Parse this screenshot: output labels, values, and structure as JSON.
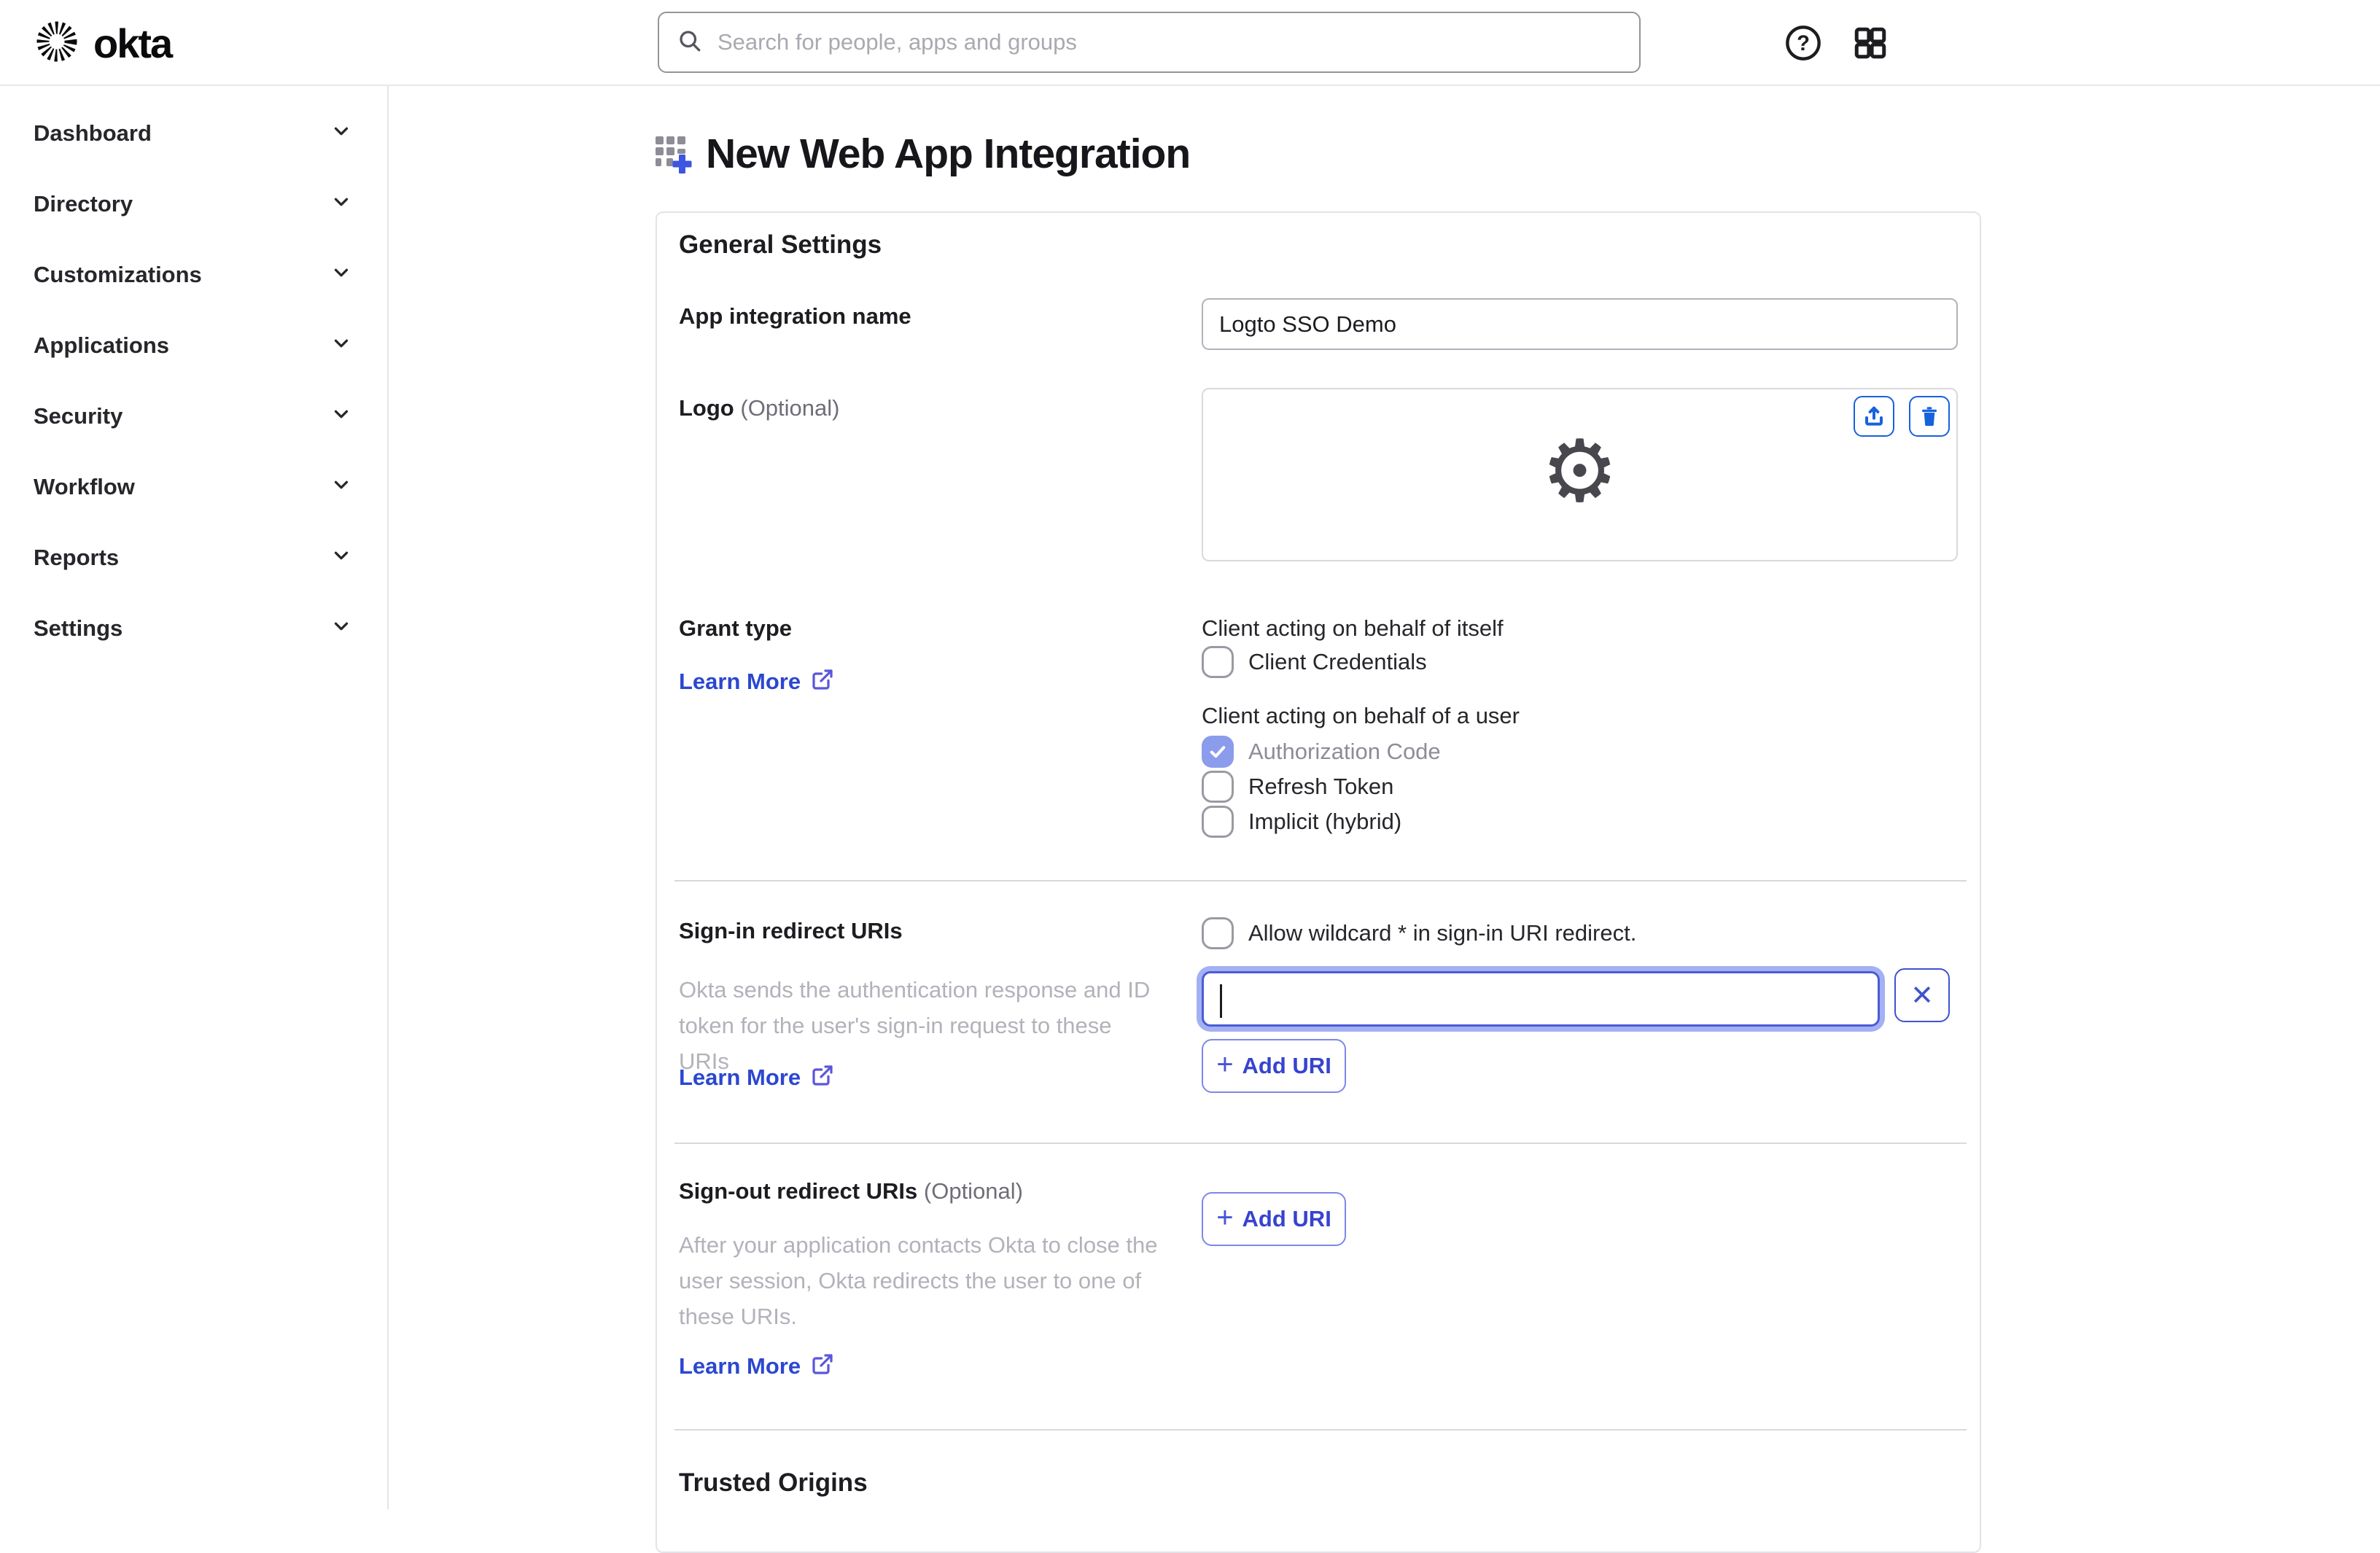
{
  "header": {
    "brand": "okta",
    "search_placeholder": "Search for people, apps and groups"
  },
  "sidebar": {
    "items": [
      {
        "label": "Dashboard"
      },
      {
        "label": "Directory"
      },
      {
        "label": "Customizations"
      },
      {
        "label": "Applications"
      },
      {
        "label": "Security"
      },
      {
        "label": "Workflow"
      },
      {
        "label": "Reports"
      },
      {
        "label": "Settings"
      }
    ]
  },
  "page": {
    "title": "New Web App Integration"
  },
  "general": {
    "heading": "General Settings",
    "app_name": {
      "label": "App integration name",
      "value": "Logto SSO Demo"
    },
    "logo": {
      "label": "Logo",
      "optional": "(Optional)"
    },
    "grant": {
      "label": "Grant type",
      "learn_more": "Learn More",
      "self_heading": "Client acting on behalf of itself",
      "self_option": {
        "label": "Client Credentials",
        "checked": false
      },
      "user_heading": "Client acting on behalf of a user",
      "user_options": [
        {
          "label": "Authorization Code",
          "checked": true,
          "disabled": true
        },
        {
          "label": "Refresh Token",
          "checked": false
        },
        {
          "label": "Implicit (hybrid)",
          "checked": false
        }
      ]
    },
    "signin": {
      "label": "Sign-in redirect URIs",
      "wildcard_label": "Allow wildcard * in sign-in URI redirect.",
      "description": "Okta sends the authentication response and ID token for the user's sign-in request to these URIs",
      "learn_more": "Learn More",
      "input_value": "",
      "clear_label": "✕",
      "add_uri": "Add URI",
      "plus": "+"
    },
    "signout": {
      "label": "Sign-out redirect URIs",
      "optional": "(Optional)",
      "description": "After your application contacts Okta to close the user session, Okta redirects the user to one of these URIs.",
      "learn_more": "Learn More",
      "add_uri": "Add URI",
      "plus": "+"
    },
    "trusted_heading": "Trusted Origins"
  },
  "icons": {
    "gear": "⚙"
  },
  "colors": {
    "okta_blue": "#1662dd",
    "link_blue": "#2b47d1",
    "indigo": "#3f53cf",
    "focus_border": "#4b5bd6",
    "focus_ring": "#a3b0f3",
    "checked_checkbox": "#8b9cec",
    "title_plus": "#3d55e0"
  }
}
